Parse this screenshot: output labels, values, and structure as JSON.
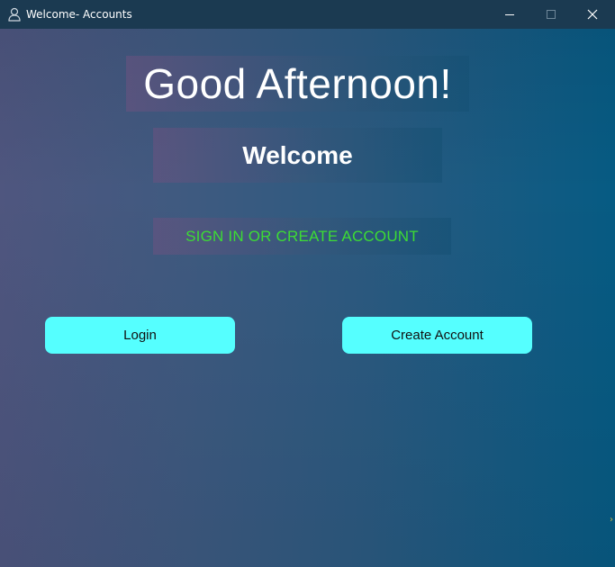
{
  "window": {
    "title": "Welcome- Accounts",
    "icon": "user-icon",
    "controls": [
      "minimize-icon",
      "maximize-icon",
      "close-icon"
    ]
  },
  "main": {
    "greeting": "Good Afternoon!",
    "welcome": "Welcome",
    "subtitle": "SIGN IN OR CREATE ACCOUNT",
    "login_label": "Login",
    "create_label": "Create Account"
  },
  "colors": {
    "titlebar": "#1b3a51",
    "button": "#55ffff",
    "subtitle_text": "#3ddc34",
    "text": "#ffffff"
  }
}
